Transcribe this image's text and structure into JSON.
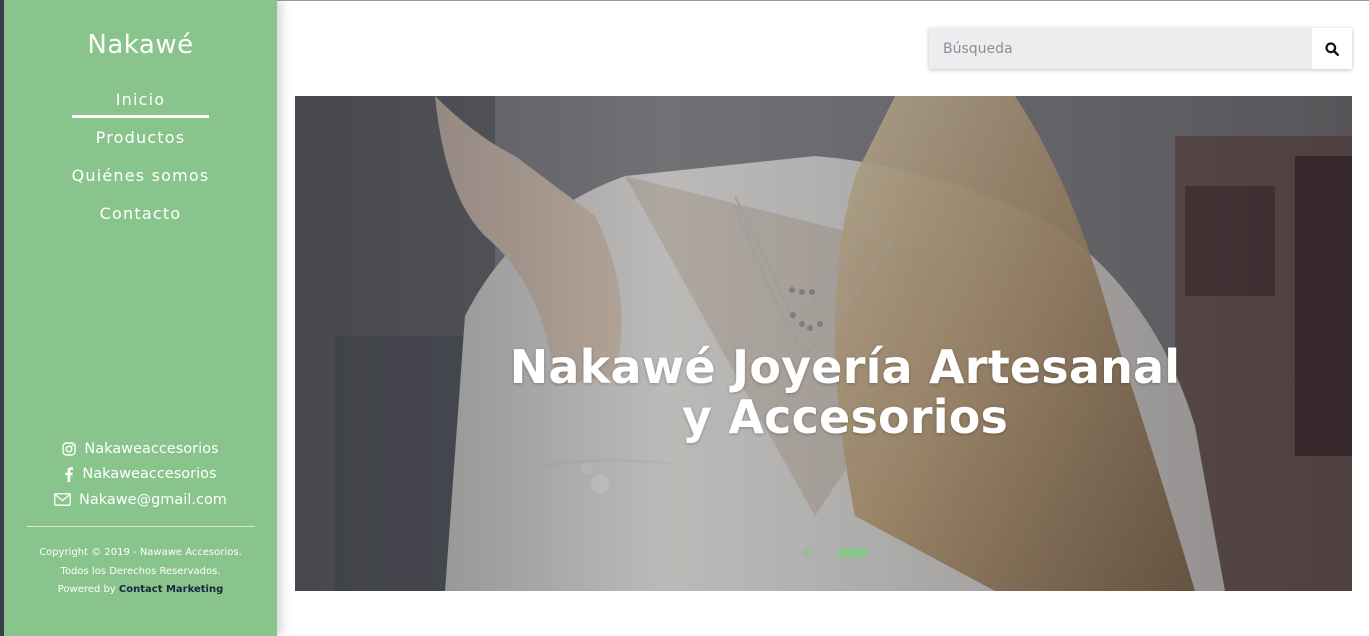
{
  "sidebar": {
    "brand": "Nakawé",
    "nav": [
      {
        "label": "Inicio",
        "active": true
      },
      {
        "label": "Productos",
        "active": false
      },
      {
        "label": "Quiénes somos",
        "active": false
      },
      {
        "label": "Contacto",
        "active": false
      }
    ],
    "social": {
      "instagram": {
        "icon": "instagram-icon",
        "label": "Nakaweaccesorios"
      },
      "facebook": {
        "icon": "facebook-icon",
        "label": "Nakaweaccesorios"
      },
      "email": {
        "icon": "envelope-icon",
        "label": "Nakawe@gmail.com"
      }
    },
    "footer": {
      "copyright": "Copyright © 2019 - Nawawe Accesorios.",
      "rights": "Todos los Derechos Reservados.",
      "powered_prefix": "Powered by",
      "powered_link": "Contact Marketing"
    }
  },
  "search": {
    "placeholder": "Búsqueda",
    "value": "",
    "icon": "search-icon"
  },
  "hero": {
    "title_line1": "Nakawé Joyería Artesanal",
    "title_line2": "y Accesorios",
    "slides": 2,
    "active_slide": 2
  },
  "colors": {
    "sidebar_green": "#88c48b",
    "footer_link": "#1c2540",
    "window_edge": "#3b3f4e"
  }
}
